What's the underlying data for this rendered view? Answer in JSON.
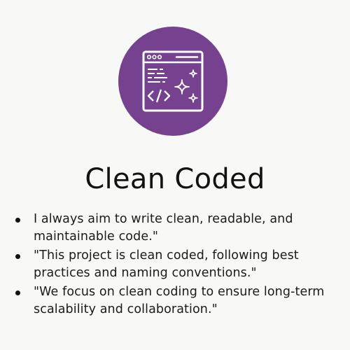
{
  "icon": {
    "name": "clean-code-browser-icon",
    "circle_color": "#764290"
  },
  "title": "Clean Coded",
  "points": [
    "I always aim to write clean, readable, and maintainable code.\"",
    "\"This project is clean coded, following best practices and naming conventions.\"",
    "\"We focus on clean coding to ensure long-term scalability and collaboration.\""
  ]
}
